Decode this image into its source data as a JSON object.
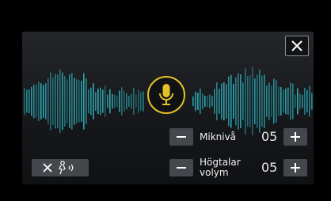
{
  "dialog": {
    "close_icon": "close-icon",
    "mic_icon": "microphone-icon",
    "accent_color": "#e3c12a",
    "wave_color": "#2fb8c4"
  },
  "controls": {
    "mic_level": {
      "label": "Miknivå",
      "value": "05",
      "minus_icon": "minus-icon",
      "plus_icon": "plus-icon"
    },
    "speaker_volume": {
      "label_line1": "Högtalar",
      "label_line2": "volym",
      "value": "05",
      "minus_icon": "minus-icon",
      "plus_icon": "plus-icon"
    },
    "mute_voice": {
      "icons": [
        "close-icon",
        "voice-speaking-icon"
      ]
    }
  }
}
